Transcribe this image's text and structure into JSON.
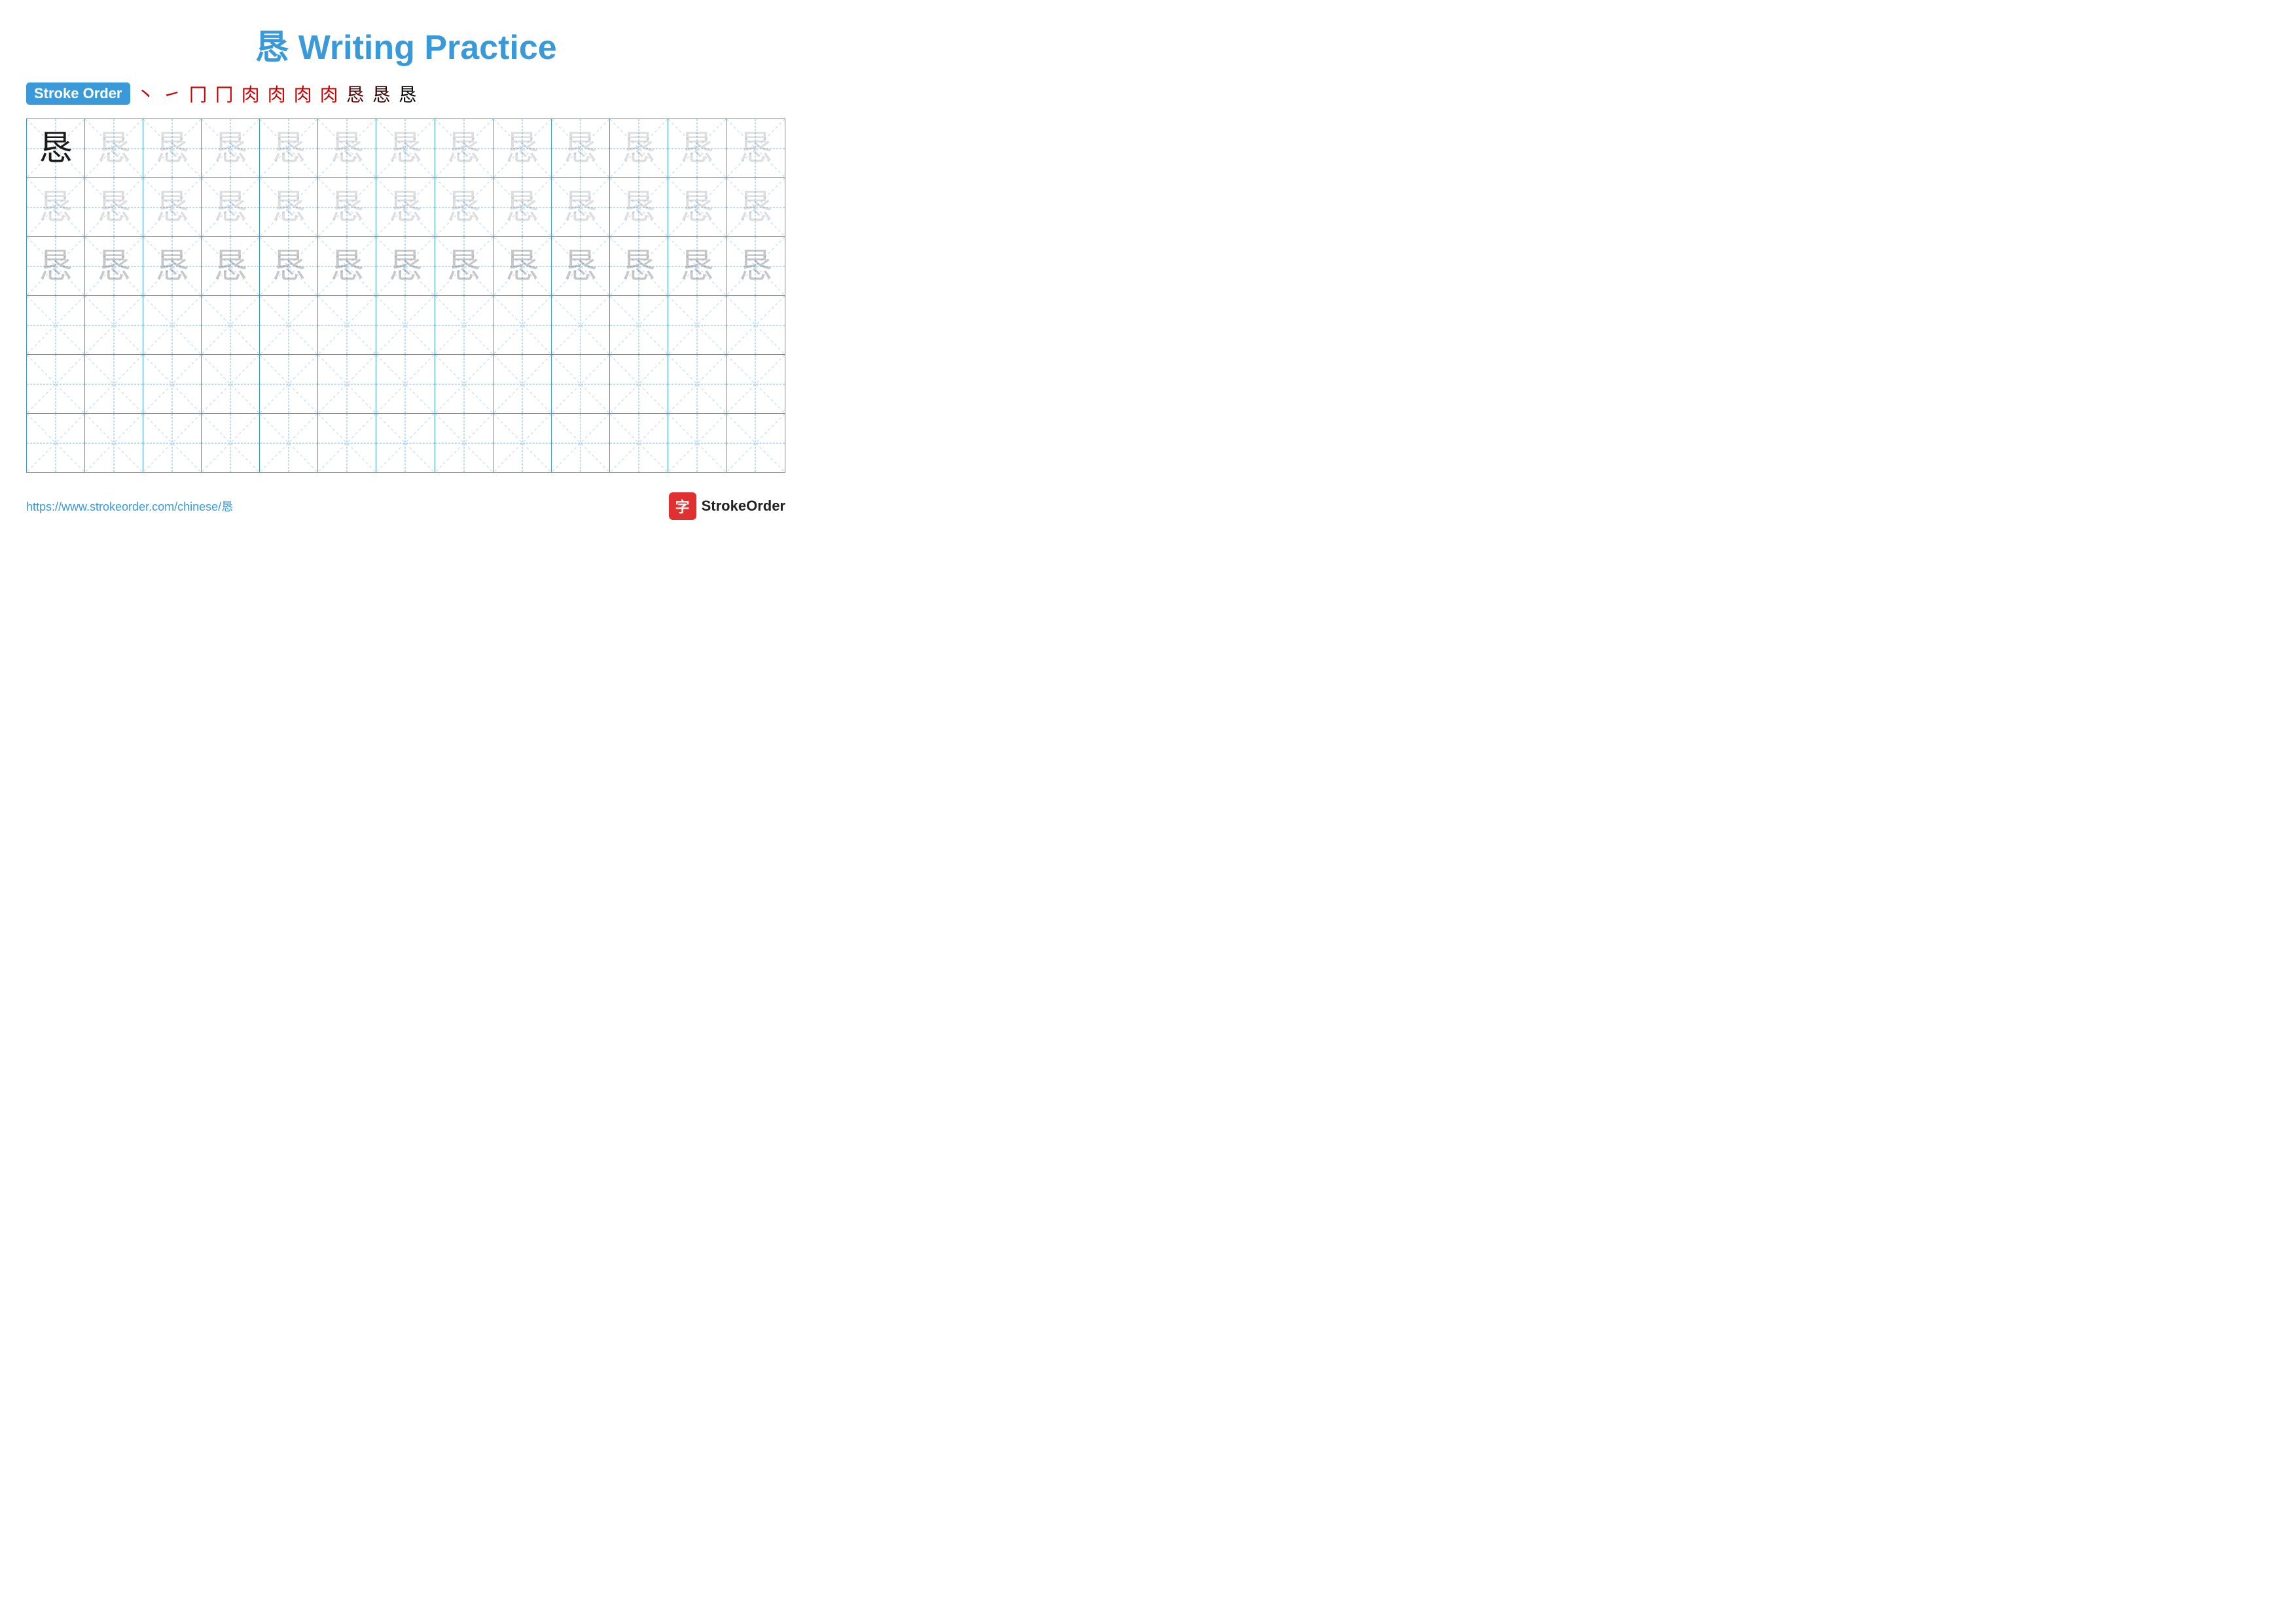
{
  "title": {
    "character": "恳",
    "text": "Writing Practice",
    "full": "恳 Writing Practice"
  },
  "stroke_order": {
    "badge_label": "Stroke Order",
    "strokes": [
      "丶",
      "㇀",
      "冂",
      "冂",
      "肉",
      "肉",
      "肉",
      "肉",
      "恳",
      "恳",
      "恳"
    ]
  },
  "grid": {
    "rows": 6,
    "cols": 13,
    "character": "恳",
    "filled_rows": [
      {
        "type": "dark_then_light",
        "dark_count": 1,
        "opacity": [
          1,
          0.13
        ]
      },
      {
        "type": "light",
        "opacity": 0.13
      },
      {
        "type": "light",
        "opacity": 0.13
      },
      {
        "type": "empty"
      },
      {
        "type": "empty"
      },
      {
        "type": "empty"
      }
    ]
  },
  "footer": {
    "url": "https://www.strokeorder.com/chinese/恳",
    "logo_icon": "字",
    "logo_text": "StrokeOrder"
  }
}
